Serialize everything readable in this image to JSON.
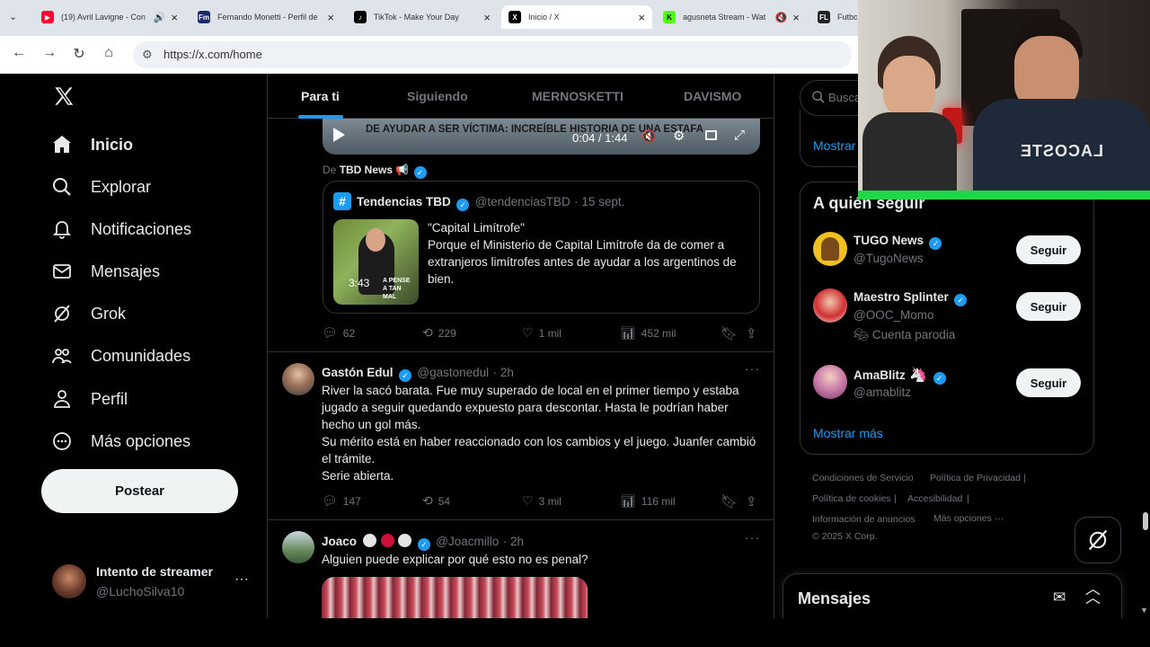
{
  "browser": {
    "tabs": [
      {
        "title": "(19) Avril Lavigne - Con",
        "fav": "▶",
        "fav_color": "#ff0033",
        "active": false
      },
      {
        "title": "Fernando Monetti - Perfil de",
        "fav": "Fm",
        "fav_color": "#1b2a6b",
        "active": false
      },
      {
        "title": "TikTok - Make Your Day",
        "fav": "♪",
        "fav_color": "#000000",
        "active": false
      },
      {
        "title": "Inicio / X",
        "fav": "X",
        "fav_color": "#000000",
        "active": true
      },
      {
        "title": "agusneta Stream - Wat",
        "fav": "K",
        "fav_color": "#53fc18",
        "active": false
      },
      {
        "title": "Futbo",
        "fav": "FL",
        "fav_color": "#222222",
        "active": false
      }
    ],
    "url": "https://x.com/home"
  },
  "nav": {
    "items": [
      {
        "label": "Inicio",
        "icon": "home-icon"
      },
      {
        "label": "Explorar",
        "icon": "search-icon"
      },
      {
        "label": "Notificaciones",
        "icon": "bell-icon"
      },
      {
        "label": "Mensajes",
        "icon": "mail-icon"
      },
      {
        "label": "Grok",
        "icon": "grok-icon"
      },
      {
        "label": "Comunidades",
        "icon": "communities-icon"
      },
      {
        "label": "Perfil",
        "icon": "person-icon"
      },
      {
        "label": "Más opciones",
        "icon": "more-circle-icon"
      }
    ],
    "post_label": "Postear",
    "account": {
      "name": "Intento de streamer",
      "handle": "@LuchoSilva10"
    }
  },
  "feed": {
    "tabs": [
      "Para ti",
      "Siguiendo",
      "MERNOSKETTI",
      "DAVISMO"
    ],
    "video": {
      "caption": "DE AYUDAR A SER VÍCTIMA: INCREÍBLE HISTORIA DE UNA ESTAFA",
      "time": "0:04 / 1:44"
    },
    "source_prefix": "De",
    "source_name": "TBD News",
    "quote": {
      "name": "Tendencias TBD",
      "handle": "@tendenciasTBD",
      "date": "· 15 sept.",
      "thumb_time": "3:43",
      "thumb_caption": "A PENSE A TAN MAL",
      "title": "\"Capital Limítrofe\"",
      "body": "Porque el Ministerio de Capital Limítrofe da de comer a extranjeros limítrofes antes de ayudar a los argentinos de bien."
    },
    "stats1": {
      "replies": "62",
      "reposts": "229",
      "likes": "1 mil",
      "views": "452 mil"
    },
    "tweet2": {
      "name": "Gastón Edul",
      "handle": "@gastonedul",
      "time": "· 2h",
      "lines": [
        "River la sacó barata. Fue muy superado de local en el primer tiempo y estaba jugado a seguir quedando expuesto para descontar. Hasta le podrían haber hecho un gol más.",
        "Su mérito está en haber reaccionado con los cambios y el juego. Juanfer cambió el trámite.",
        "Serie abierta."
      ]
    },
    "stats2": {
      "replies": "147",
      "reposts": "54",
      "likes": "3 mil",
      "views": "116 mil"
    },
    "tweet3": {
      "name": "Joaco",
      "handle": "@Joacmillo",
      "time": "· 2h",
      "text": "Alguien puede explicar por qué esto no es penal?"
    }
  },
  "right": {
    "search_placeholder": "Busca",
    "show_more_top": "Mostrar",
    "follow_title": "A quién seguir",
    "follow": [
      {
        "name": "TUGO News",
        "handle": "@TugoNews",
        "extra": ""
      },
      {
        "name": "Maestro Splinter",
        "handle": "@OOC_Momo",
        "extra": "Cuenta parodia"
      },
      {
        "name": "AmaBlitz",
        "handle": "@amablitz",
        "extra": ""
      }
    ],
    "follow_label": "Seguir",
    "show_more": "Mostrar más",
    "footer": [
      "Condiciones de Servicio",
      "Política de Privacidad",
      "Política de cookies",
      "Accesibilidad",
      "Información de anuncios",
      "Más opciones ···",
      "© 2025 X Corp."
    ],
    "messages_title": "Mensajes"
  },
  "webcam": {
    "shirt_text": "LACOSTE"
  }
}
